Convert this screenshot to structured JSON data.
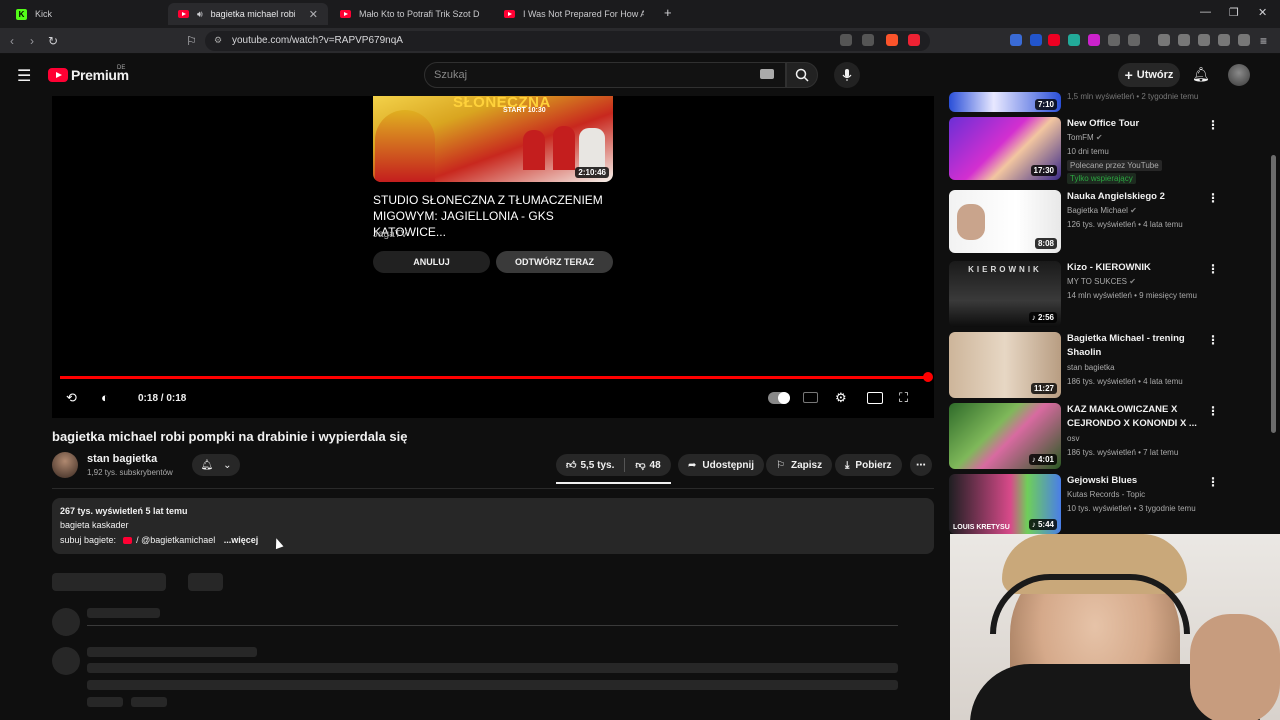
{
  "browser": {
    "tabs": [
      {
        "title": "Kick",
        "icon": "kick-favicon"
      },
      {
        "title": "bagietka michael robi pompki",
        "icon": "youtube-favicon",
        "active": true
      },
      {
        "title": "Mało Kto to Potrafi Trik Szot Dla Xayo",
        "icon": "youtube-favicon"
      },
      {
        "title": "I Was Not Prepared For How Aggressive",
        "icon": "youtube-favicon"
      }
    ],
    "url": "youtube.com/watch?v=RAPVP679nqA"
  },
  "header": {
    "logo_text": "Premium",
    "country_code": "DE",
    "search_placeholder": "Szukaj",
    "create_label": "Utwórz"
  },
  "player": {
    "next_video": {
      "thumb_title": "SŁONECZNA",
      "thumb_subtitle": "START 10:30",
      "duration": "2:10:46",
      "title": "STUDIO SŁONECZNA Z TŁUMACZENIEM MIGOWYM: JAGIELLONIA - GKS KATOWICE...",
      "channel": "JagaTV",
      "cancel_label": "ANULUJ",
      "play_label": "ODTWÓRZ TERAZ"
    },
    "time": "0:18 / 0:18",
    "progress": 1.0
  },
  "video": {
    "title": "bagietka michael robi pompki na drabinie i wypierdala się",
    "channel_name": "stan bagietka",
    "subscribers": "1,92 tys. subskrybentów",
    "likes": "5,5 tys.",
    "dislikes": "48",
    "share_label": "Udostępnij",
    "save_label": "Zapisz",
    "download_label": "Pobierz"
  },
  "description": {
    "stats": "267 tys. wyświetleń  5 lat temu",
    "line1": "bagieta kaskader",
    "line2_prefix": "subuj bagiete:",
    "handle": "/ @bagietkamichael",
    "more": "...więcej"
  },
  "sidebar": [
    {
      "title": "",
      "channel": "",
      "meta": "1,5 mln wyświetleń • 2 tygodnie temu",
      "duration": "7:10",
      "thumb": "partial"
    },
    {
      "title": "New Office Tour",
      "channel": "TomFM",
      "verified": true,
      "meta": "10 dni temu",
      "badge": "Polecane przez YouTube",
      "member": "Tylko wspierający",
      "duration": "17:30"
    },
    {
      "title": "Nauka Angielskiego 2",
      "channel": "Bagietka Michael",
      "verified": true,
      "meta": "126 tys. wyświetleń • 4 lata temu",
      "duration": "8:08"
    },
    {
      "title": "Kizo - KIEROWNIK",
      "channel": "MY TO SUKCES",
      "verified": true,
      "meta": "14 mln wyświetleń • 9 miesięcy temu",
      "duration": "2:56",
      "thumb_text": "KIEROWNIK"
    },
    {
      "title": "Bagietka Michael - trening Shaolin",
      "channel": "stan bagietka",
      "meta": "186 tys. wyświetleń • 4 lata temu",
      "duration": "11:27"
    },
    {
      "title": "KAZ MAKŁOWICZANE X CEJRONDO X KONONDI X ...",
      "channel": "osv",
      "meta": "186 tys. wyświetleń • 7 lat temu",
      "duration": "4:01"
    },
    {
      "title": "Gejowski Blues",
      "channel": "Kutas Records - Topic",
      "meta": "10 tys. wyświetleń • 3 tygodnie temu",
      "duration": "5:44",
      "thumb_text": "LOUIS KRETYSU"
    }
  ],
  "colors": {
    "accent": "#ff0033",
    "background": "#0f0f0f",
    "surface": "#272727"
  }
}
